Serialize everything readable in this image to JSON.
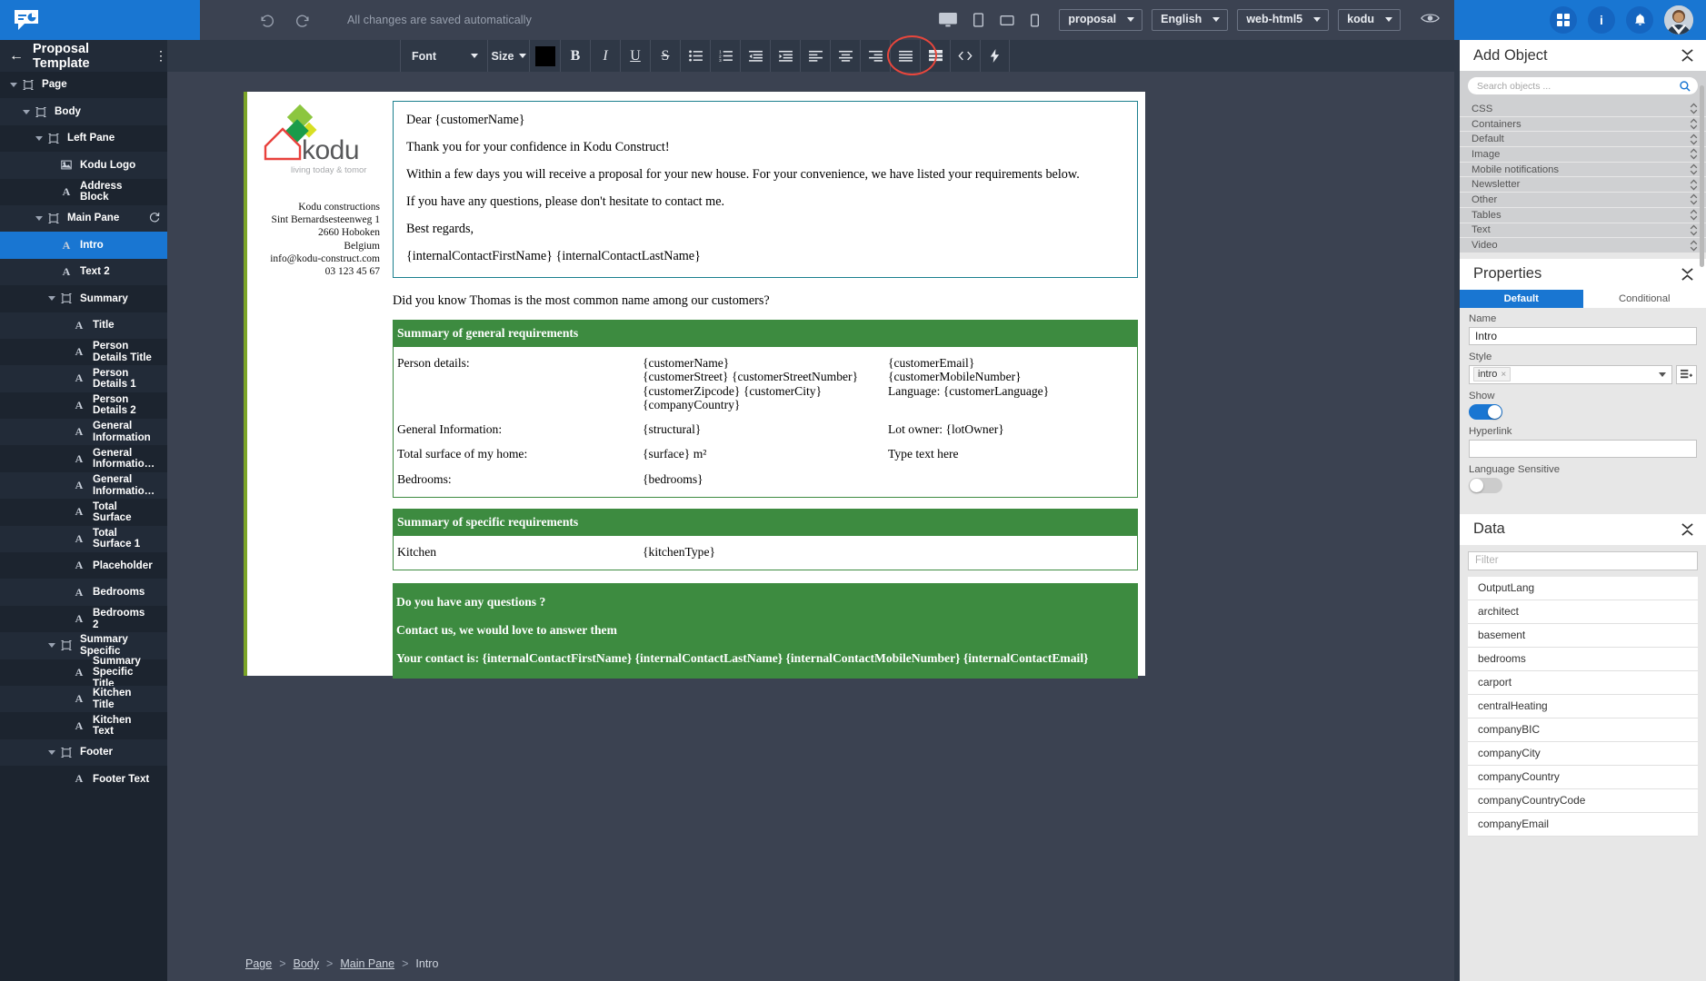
{
  "topbar": {
    "app_logo": "kodu-speech-bubble-logo",
    "undo_label": "undo-icon",
    "redo_label": "redo-icon",
    "save_message": "All changes are saved automatically",
    "device_icons": [
      "desktop-icon",
      "tablet-icon",
      "tablet-landscape-icon",
      "mobile-icon"
    ],
    "chips": [
      {
        "label": "proposal"
      },
      {
        "label": "English"
      },
      {
        "label": "web-html5"
      },
      {
        "label": "kodu"
      }
    ],
    "preview_icon": "eye-icon",
    "apps_icon": "grid-apps-icon",
    "info_icon": "info-icon",
    "notifications_icon": "bell-icon",
    "avatar_icon": "user-avatar"
  },
  "titlebar": {
    "back_icon": "back-arrow-icon",
    "title": "Proposal Template",
    "menu_icon": "kebab-menu-icon"
  },
  "format_toolbar": {
    "font_label": "Font",
    "size_label": "Size",
    "color_swatch": "#000000",
    "bold": "B",
    "italic": "I",
    "underline": "U",
    "strikethrough": "S",
    "buttons": [
      "bullet-list-icon",
      "numbered-list-icon",
      "decrease-indent-icon",
      "increase-indent-icon",
      "align-left-icon",
      "align-center-icon",
      "align-right-icon",
      "align-justify-icon",
      "table-icon",
      "code-icon",
      "lightning-icon"
    ]
  },
  "sidebar": {
    "items": [
      {
        "label": "Page",
        "depth": 0,
        "icon": "frame-icon",
        "caret": true,
        "selected": false
      },
      {
        "label": "Body",
        "depth": 1,
        "icon": "frame-icon",
        "caret": true,
        "selected": false
      },
      {
        "label": "Left Pane",
        "depth": 2,
        "icon": "frame-icon",
        "caret": true,
        "selected": false
      },
      {
        "label": "Kodu Logo",
        "depth": 3,
        "icon": "image-icon",
        "caret": false,
        "selected": false
      },
      {
        "label": "Address Block",
        "depth": 3,
        "icon": "text-icon",
        "caret": false,
        "selected": false
      },
      {
        "label": "Main Pane",
        "depth": 2,
        "icon": "frame-icon",
        "caret": true,
        "selected": false,
        "refresh": true
      },
      {
        "label": "Intro",
        "depth": 3,
        "icon": "text-icon",
        "caret": false,
        "selected": true
      },
      {
        "label": "Text 2",
        "depth": 3,
        "icon": "text-icon",
        "caret": false,
        "selected": false
      },
      {
        "label": "Summary",
        "depth": 3,
        "icon": "frame-icon",
        "caret": true,
        "selected": false
      },
      {
        "label": "Title",
        "depth": 4,
        "icon": "text-icon",
        "caret": false,
        "selected": false
      },
      {
        "label": "Person Details Title",
        "depth": 4,
        "icon": "text-icon",
        "caret": false,
        "selected": false
      },
      {
        "label": "Person Details 1",
        "depth": 4,
        "icon": "text-icon",
        "caret": false,
        "selected": false
      },
      {
        "label": "Person Details 2",
        "depth": 4,
        "icon": "text-icon",
        "caret": false,
        "selected": false
      },
      {
        "label": "General Information",
        "depth": 4,
        "icon": "text-icon",
        "caret": false,
        "selected": false
      },
      {
        "label": "General Informatio…",
        "depth": 4,
        "icon": "text-icon",
        "caret": false,
        "selected": false
      },
      {
        "label": "General Informatio…",
        "depth": 4,
        "icon": "text-icon",
        "caret": false,
        "selected": false
      },
      {
        "label": "Total Surface",
        "depth": 4,
        "icon": "text-icon",
        "caret": false,
        "selected": false
      },
      {
        "label": "Total Surface 1",
        "depth": 4,
        "icon": "text-icon",
        "caret": false,
        "selected": false
      },
      {
        "label": "Placeholder",
        "depth": 4,
        "icon": "text-icon",
        "caret": false,
        "selected": false
      },
      {
        "label": "Bedrooms",
        "depth": 4,
        "icon": "text-icon",
        "caret": false,
        "selected": false
      },
      {
        "label": "Bedrooms 2",
        "depth": 4,
        "icon": "text-icon",
        "caret": false,
        "selected": false
      },
      {
        "label": "Summary Specific",
        "depth": 3,
        "icon": "frame-icon",
        "caret": true,
        "selected": false
      },
      {
        "label": "Summary Specific Title",
        "depth": 4,
        "icon": "text-icon",
        "caret": false,
        "selected": false
      },
      {
        "label": "Kitchen Title",
        "depth": 4,
        "icon": "text-icon",
        "caret": false,
        "selected": false
      },
      {
        "label": "Kitchen Text",
        "depth": 4,
        "icon": "text-icon",
        "caret": false,
        "selected": false
      },
      {
        "label": "Footer",
        "depth": 3,
        "icon": "frame-icon",
        "caret": true,
        "selected": false
      },
      {
        "label": "Footer Text",
        "depth": 4,
        "icon": "text-icon",
        "caret": false,
        "selected": false
      }
    ]
  },
  "document": {
    "company_name": "kodu",
    "company_tagline": "living today & tomorrow",
    "address": [
      "Kodu constructions",
      "Sint Bernardsesteenweg 1",
      "2660 Hoboken",
      "Belgium",
      "info@kodu-construct.com",
      "03 123 45 67"
    ],
    "intro": {
      "l1": "Dear {customerName}",
      "l2": "Thank you for your confidence in Kodu Construct!",
      "l3": "Within a few days you will receive a proposal for your new house. For your convenience, we have listed your requirements below.",
      "l4": "If you have any questions, please don't hesitate to contact me.",
      "l5": "Best regards,",
      "l6": "{internalContactFirstName} {internalContactLastName}"
    },
    "did_you_know": "Did you know Thomas is the most common name among our customers?",
    "general": {
      "heading": "Summary of general requirements",
      "rows": [
        {
          "c1": "Person details:",
          "c2": [
            "{customerName}",
            "{customerStreet} {customerStreetNumber}",
            "{customerZipcode} {customerCity}",
            "{companyCountry}"
          ],
          "c3": [
            "{customerEmail}",
            "{customerMobileNumber}",
            "Language: {customerLanguage}"
          ]
        },
        {
          "c1": "General Information:",
          "c2": [
            "{structural}"
          ],
          "c3": [
            "Lot owner: {lotOwner}"
          ]
        },
        {
          "c1": "Total surface of my home:",
          "c2": [
            "{surface} m²"
          ],
          "c3": [
            "Type text here"
          ]
        },
        {
          "c1": "Bedrooms:",
          "c2": [
            "{bedrooms}"
          ],
          "c3": []
        }
      ]
    },
    "specific": {
      "heading": "Summary of specific requirements",
      "rows": [
        {
          "c1": "Kitchen",
          "c2": [
            "{kitchenType}"
          ],
          "c3": []
        }
      ]
    },
    "questions": {
      "l1": "Do you have any questions ?",
      "l2": "Contact us, we would love to answer them",
      "l3": "Your contact is: {internalContactFirstName} {internalContactLastName} {internalContactMobileNumber} {internalContactEmail}"
    }
  },
  "breadcrumb": {
    "items": [
      "Page",
      "Body",
      "Main Pane",
      "Intro"
    ],
    "separator": ">"
  },
  "right_panel": {
    "add_object": {
      "title": "Add Object",
      "collapse_icon": "collapse-icon",
      "search_placeholder": "Search objects ...",
      "search_icon": "search-icon",
      "categories": [
        "CSS",
        "Containers",
        "Default",
        "Image",
        "Mobile notifications",
        "Newsletter",
        "Other",
        "Tables",
        "Text",
        "Video"
      ]
    },
    "properties": {
      "title": "Properties",
      "collapse_icon": "collapse-icon",
      "tabs": [
        {
          "label": "Default",
          "active": true
        },
        {
          "label": "Conditional",
          "active": false
        }
      ],
      "name_label": "Name",
      "name_value": "Intro",
      "style_label": "Style",
      "style_tag": "intro",
      "style_tag_remove": "×",
      "style_add_icon": "add-style-icon",
      "show_label": "Show",
      "show_value": "on",
      "hyperlink_label": "Hyperlink",
      "hyperlink_value": "",
      "language_sensitive_label": "Language Sensitive",
      "language_sensitive_value": "off"
    },
    "data": {
      "title": "Data",
      "collapse_icon": "collapse-icon",
      "filter_placeholder": "Filter",
      "fields": [
        "OutputLang",
        "architect",
        "basement",
        "bedrooms",
        "carport",
        "centralHeating",
        "companyBIC",
        "companyCity",
        "companyCountry",
        "companyCountryCode",
        "companyEmail"
      ]
    }
  },
  "colors": {
    "brand_blue": "#1976d2",
    "dark_chrome": "#2f3846",
    "sidebar_bg": "#1c242f",
    "doc_green": "#3d8b40",
    "accent_olive": "#7ba428",
    "highlight_red": "#e8463c"
  }
}
